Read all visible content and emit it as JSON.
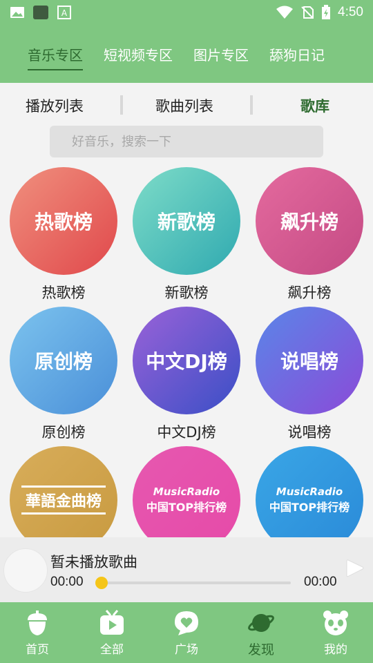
{
  "status_bar": {
    "time": "4:50"
  },
  "top_tabs": [
    {
      "label": "音乐专区",
      "active": true
    },
    {
      "label": "短视频专区",
      "active": false
    },
    {
      "label": "图片专区",
      "active": false
    },
    {
      "label": "舔狗日记",
      "active": false
    }
  ],
  "sub_tabs": [
    {
      "label": "播放列表",
      "active": false
    },
    {
      "label": "歌曲列表",
      "active": false
    },
    {
      "label": "歌库",
      "active": true
    }
  ],
  "search": {
    "placeholder": "好音乐，搜索一下"
  },
  "charts": [
    {
      "label": "热歌榜",
      "circle_text": "热歌榜",
      "gradient": [
        "#f0907e",
        "#e0484b"
      ]
    },
    {
      "label": "新歌榜",
      "circle_text": "新歌榜",
      "gradient": [
        "#7edcc8",
        "#2fa9b0"
      ]
    },
    {
      "label": "飙升榜",
      "circle_text": "飙升榜",
      "gradient": [
        "#e46a9e",
        "#c44a84"
      ]
    },
    {
      "label": "原创榜",
      "circle_text": "原创榜",
      "gradient": [
        "#7cc3ee",
        "#4a8fd8"
      ]
    },
    {
      "label": "中文DJ榜",
      "circle_text": "中文DJ榜",
      "gradient": [
        "#9a62d8",
        "#3a4fc6"
      ]
    },
    {
      "label": "说唱榜",
      "circle_text": "说唱榜",
      "gradient": [
        "#5a86e8",
        "#8b4ad8"
      ]
    },
    {
      "label": "",
      "circle_text": "華語金曲榜",
      "gradient": [
        "#d8ad5a",
        "#c89a40"
      ]
    },
    {
      "label": "",
      "logo_line1": "MusicRadio",
      "logo_line2": "中国TOP排行榜",
      "gradient": [
        "#e658b0",
        "#e64aa8"
      ]
    },
    {
      "label": "",
      "logo_line1": "MusicRadio",
      "logo_line2": "中国TOP排行榜",
      "gradient": [
        "#3aa6e6",
        "#2a8ad8"
      ]
    }
  ],
  "player": {
    "title": "暂未播放歌曲",
    "current_time": "00:00",
    "total_time": "00:00",
    "progress": 0
  },
  "bottom_nav": [
    {
      "label": "首页",
      "icon": "acorn-icon",
      "active": false
    },
    {
      "label": "全部",
      "icon": "tv-icon",
      "active": false
    },
    {
      "label": "广场",
      "icon": "heart-bubble-icon",
      "active": false
    },
    {
      "label": "发现",
      "icon": "planet-icon",
      "active": true
    },
    {
      "label": "我的",
      "icon": "panda-icon",
      "active": false
    }
  ],
  "colors": {
    "primary": "#7fc781",
    "active_text": "#2e6b30",
    "progress": "#f5c518"
  }
}
